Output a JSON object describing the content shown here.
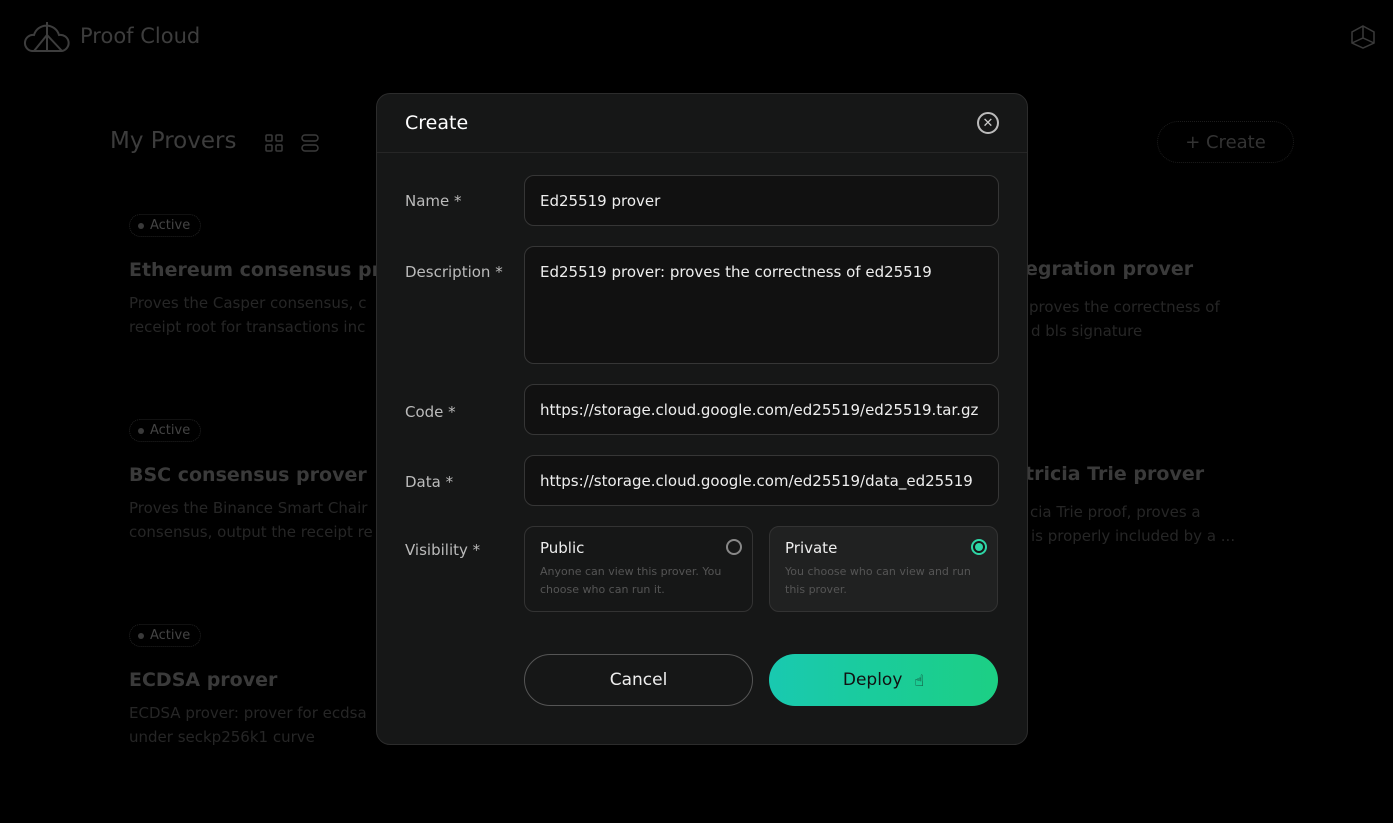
{
  "app": {
    "name": "Proof Cloud"
  },
  "page": {
    "title": "My Provers",
    "create_label": "+ Create"
  },
  "cards_left": [
    {
      "status": "Active",
      "title": "Ethereum consensus pro",
      "desc": [
        "Proves the Casper consensus, c",
        "receipt root for transactions inc"
      ]
    },
    {
      "status": "Active",
      "title": "BSC consensus prover",
      "desc": [
        "Proves the Binance Smart Chair",
        "consensus, output the receipt re"
      ]
    },
    {
      "status": "Active",
      "title": "ECDSA prover",
      "desc": [
        "ECDSA prover: prover for ecdsa",
        "under seckp256k1 curve"
      ]
    }
  ],
  "cards_right": [
    {
      "title": "egration prover",
      "desc": [
        "proves the correctness of",
        "d bls signature"
      ]
    },
    {
      "title": "tricia Trie prover",
      "desc": [
        "cia Trie proof, proves a",
        "is properly included by a ..."
      ]
    }
  ],
  "modal": {
    "title": "Create",
    "name_label": "Name *",
    "name_value": "Ed25519 prover",
    "desc_label": "Description *",
    "desc_value": "Ed25519 prover: proves the correctness of ed25519",
    "code_label": "Code *",
    "code_value": "https://storage.cloud.google.com/ed25519/ed25519.tar.gz",
    "data_label": "Data *",
    "data_value": "https://storage.cloud.google.com/ed25519/data_ed25519",
    "visibility_label": "Visibility *",
    "public": {
      "title": "Public",
      "desc": "Anyone can view this prover. You choose who can run it.",
      "selected": false
    },
    "private": {
      "title": "Private",
      "desc": "You choose who can view and run this prover.",
      "selected": true
    },
    "cancel": "Cancel",
    "deploy": "Deploy"
  },
  "colors": {
    "accent_start": "#19c9b0",
    "accent_end": "#1ccf84",
    "radio_selected": "#2ed6a6"
  }
}
